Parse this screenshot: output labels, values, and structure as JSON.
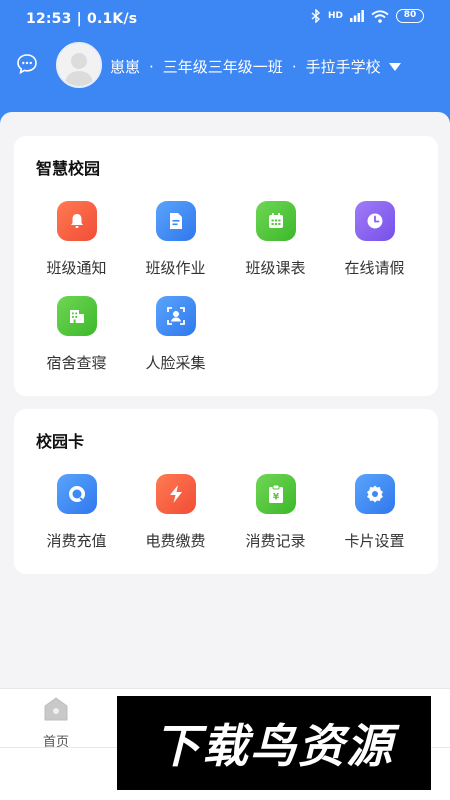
{
  "status_bar": {
    "time_speed": "12:53 | 0.1K/s",
    "signal_text": "HD",
    "battery": "80"
  },
  "profile": {
    "name": "崽崽",
    "class": "三年级三年级一班",
    "school": "手拉手学校"
  },
  "smart_campus": {
    "title": "智慧校园",
    "items": [
      {
        "label": "班级通知",
        "icon": "bell-icon",
        "color": "#f7623f"
      },
      {
        "label": "班级作业",
        "icon": "homework-icon",
        "color": "#3d89f5"
      },
      {
        "label": "班级课表",
        "icon": "schedule-icon",
        "color": "#55c73c"
      },
      {
        "label": "在线请假",
        "icon": "clock-icon",
        "color": "#8a63f0"
      },
      {
        "label": "宿舍查寝",
        "icon": "building-icon",
        "color": "#55c73c"
      },
      {
        "label": "人脸采集",
        "icon": "face-scan-icon",
        "color": "#3d89f5"
      }
    ]
  },
  "campus_card": {
    "title": "校园卡",
    "items": [
      {
        "label": "消费充值",
        "icon": "recharge-icon",
        "color": "#3d89f5"
      },
      {
        "label": "电费缴费",
        "icon": "lightning-icon",
        "color": "#f7623f"
      },
      {
        "label": "消费记录",
        "icon": "record-icon",
        "color": "#55c73c"
      },
      {
        "label": "卡片设置",
        "icon": "settings-icon",
        "color": "#3d89f5"
      }
    ]
  },
  "bottom_nav": {
    "home_label": "首页"
  },
  "watermark": {
    "text": "下载鸟资源"
  },
  "colors": {
    "header_blue": "#3d87f5",
    "background": "#f4f4f6"
  }
}
